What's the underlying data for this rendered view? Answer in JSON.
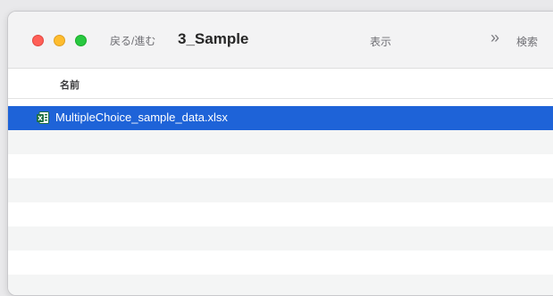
{
  "toolbar": {
    "nav_label": "戻る/進む",
    "title": "3_Sample",
    "view_label": "表示",
    "more_icon": "»",
    "search_label": "検索"
  },
  "columns": {
    "name": "名前"
  },
  "files": [
    {
      "name": "MultipleChoice_sample_data.xlsx",
      "icon": "excel-file-icon",
      "selected": true
    }
  ],
  "colors": {
    "selection": "#1e63d8",
    "close": "#ff5f57",
    "minimize": "#febc2e",
    "maximize": "#28c840"
  }
}
